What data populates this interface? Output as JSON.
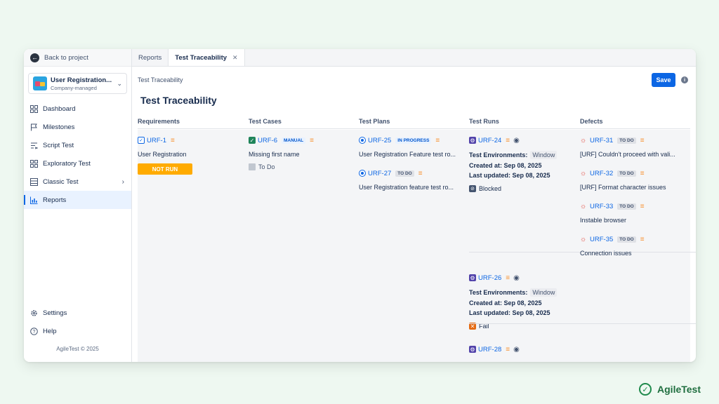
{
  "sidebar": {
    "back_label": "Back to project",
    "project_name": "User Registration...",
    "project_type": "Company-managed",
    "items": [
      {
        "label": "Dashboard"
      },
      {
        "label": "Milestones"
      },
      {
        "label": "Script Test"
      },
      {
        "label": "Exploratory Test"
      },
      {
        "label": "Classic Test"
      },
      {
        "label": "Reports"
      }
    ],
    "settings_label": "Settings",
    "help_label": "Help",
    "footer": "AgileTest © 2025"
  },
  "tabs": [
    {
      "label": "Reports"
    },
    {
      "label": "Test Traceability"
    }
  ],
  "breadcrumb": "Test Traceability",
  "save_label": "Save",
  "page_title": "Test Traceability",
  "columns": [
    "Requirements",
    "Test Cases",
    "Test Plans",
    "Test Runs",
    "Defects"
  ],
  "requirement": {
    "key": "URF-1",
    "summary": "User Registration",
    "status": "NOT RUN"
  },
  "test_case": {
    "key": "URF-6",
    "type": "MANUAL",
    "summary": "Missing first name",
    "status": "To Do"
  },
  "test_plans": [
    {
      "key": "URF-25",
      "status": "IN PROGRESS",
      "summary": "User Registration Feature test ro..."
    },
    {
      "key": "URF-27",
      "status": "TO DO",
      "summary": "User Registration feature test ro..."
    }
  ],
  "test_runs": [
    {
      "key": "URF-24",
      "env_label": "Test Environments:",
      "env": "Window",
      "created": "Created at: Sep 08, 2025",
      "updated": "Last updated: Sep 08, 2025",
      "status": "Blocked"
    },
    {
      "key": "URF-26",
      "env_label": "Test Environments:",
      "env": "Window",
      "created": "Created at: Sep 08, 2025",
      "updated": "Last updated: Sep 08, 2025",
      "status": "Fail"
    },
    {
      "key": "URF-28"
    }
  ],
  "defects": [
    {
      "key": "URF-31",
      "status": "TO DO",
      "summary": "[URF] Couldn't proceed with vali..."
    },
    {
      "key": "URF-32",
      "status": "TO DO",
      "summary": "[URF] Format character issues"
    },
    {
      "key": "URF-33",
      "status": "TO DO",
      "summary": "Instable browser"
    },
    {
      "key": "URF-35",
      "status": "TO DO",
      "summary": "Connection issues"
    }
  ],
  "brand": "AgileTest",
  "colors": {
    "accent": "#0c66e4",
    "not_run": "#ffab00",
    "priority": "#f79232",
    "fail": "#e56910",
    "background": "#eef8f1"
  }
}
